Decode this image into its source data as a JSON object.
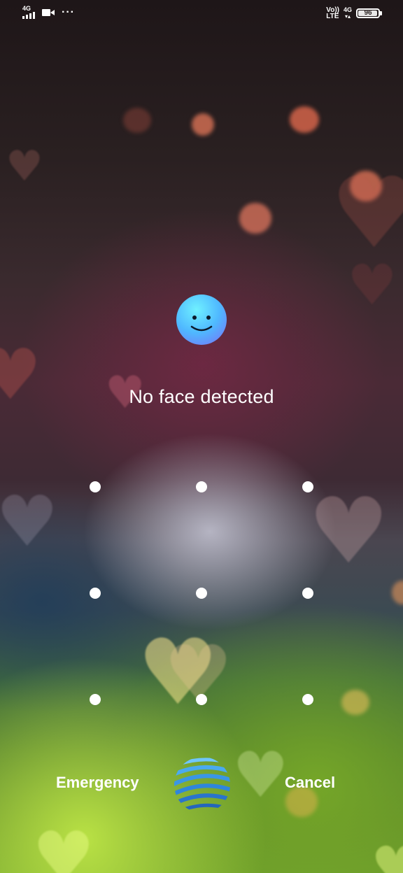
{
  "status_bar": {
    "network_type": "4G",
    "volte_label": "Vo))\nLTE",
    "data_type": "4G",
    "battery_level": "96",
    "battery_fraction": 0.96,
    "icons": [
      "signal-icon",
      "video-icon",
      "more-dots-icon",
      "volte-icon",
      "data-4g-icon",
      "battery-icon"
    ]
  },
  "face_unlock": {
    "icon": "smiley-face-icon",
    "message": "No face detected"
  },
  "pattern_lock": {
    "rows": 3,
    "cols": 3,
    "dots": [
      "1",
      "2",
      "3",
      "4",
      "5",
      "6",
      "7",
      "8",
      "9"
    ]
  },
  "bottom_bar": {
    "emergency_label": "Emergency",
    "cancel_label": "Cancel",
    "center_icon": "assistant-globe-icon"
  },
  "colors": {
    "text": "#ffffff",
    "face_gradient_start": "#6ff0ff",
    "face_gradient_end": "#7a6cf7",
    "logo_blue": "#2f8fe0"
  }
}
